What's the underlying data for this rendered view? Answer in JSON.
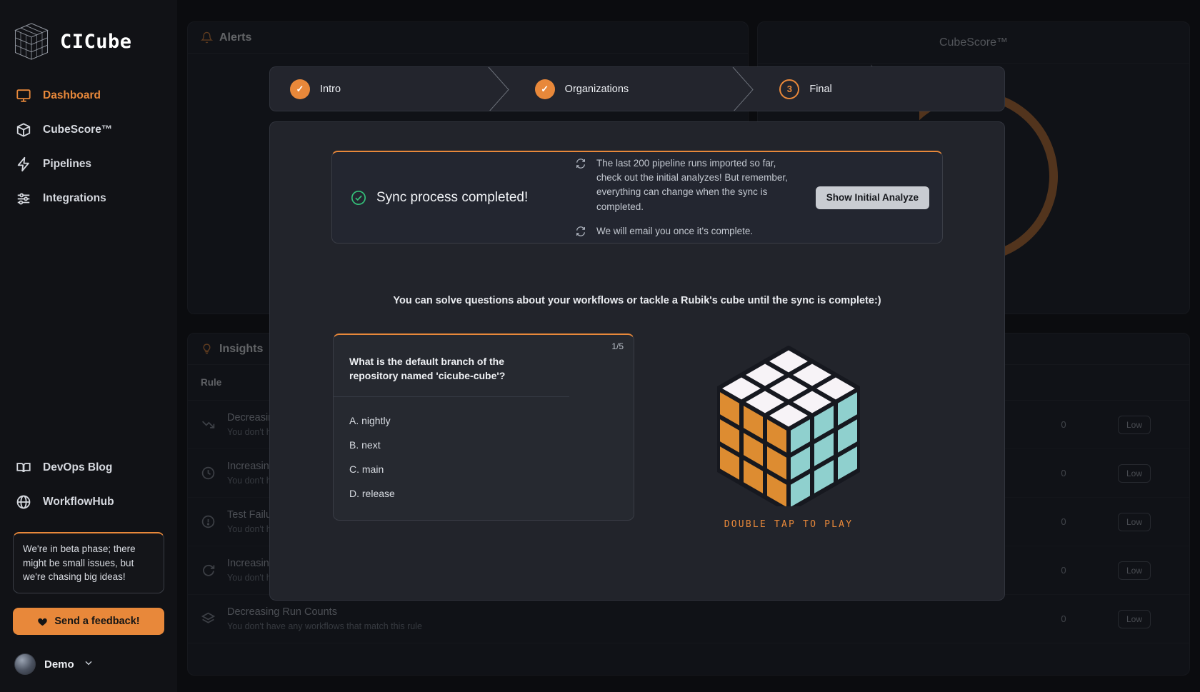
{
  "sidebar": {
    "brand": {
      "name": "CICube",
      "logo_icon": "rubiks-cube-icon"
    },
    "items": [
      {
        "label": "Dashboard",
        "icon": "monitor-icon",
        "active": true
      },
      {
        "label": "CubeScore™",
        "icon": "cube-icon",
        "active": false
      },
      {
        "label": "Pipelines",
        "icon": "lightning-icon",
        "active": false
      },
      {
        "label": "Integrations",
        "icon": "sliders-icon",
        "active": false
      }
    ],
    "bottom_items": [
      {
        "label": "DevOps Blog",
        "icon": "book-icon"
      },
      {
        "label": "WorkflowHub",
        "icon": "globe-icon"
      }
    ],
    "beta_notice": "We're in beta phase; there might be small issues, but we're chasing big ideas!",
    "feedback_button": {
      "label": "Send a feedback!",
      "icon": "heart-icon"
    },
    "user": {
      "name": "Demo",
      "chevron_icon": "chevron-down-icon",
      "avatar_icon": "avatar"
    }
  },
  "background": {
    "alerts_panel": {
      "title": "Alerts",
      "icon": "bell-icon"
    },
    "cubescore_panel": {
      "title": "CubeScore™"
    },
    "insights_panel": {
      "title": "Insights",
      "icon": "lightbulb-icon",
      "column_header": "Rule",
      "rows": [
        {
          "title": "Decreasing Run Counts",
          "subtitle": "You don't have any workflows that match this rule",
          "icon": "trend-down-icon",
          "count": "0",
          "badge": "Low"
        },
        {
          "title": "Increasing Run Durations",
          "subtitle": "You don't have any workflows that match this rule",
          "icon": "clock-icon",
          "count": "0",
          "badge": "Low"
        },
        {
          "title": "Test Failures",
          "subtitle": "You don't have any workflows that match this rule",
          "icon": "alert-circle-icon",
          "count": "0",
          "badge": "Low"
        },
        {
          "title": "Increasing Retry Counts",
          "subtitle": "You don't have any workflows that match this rule",
          "icon": "refresh-icon",
          "count": "0",
          "badge": "Low"
        },
        {
          "title": "Decreasing Run Counts",
          "subtitle": "You don't have any workflows that match this rule",
          "icon": "layers-icon",
          "count": "0",
          "badge": "Low"
        }
      ]
    }
  },
  "modal": {
    "steps": [
      {
        "label": "Intro",
        "marker": "✓",
        "state": "done"
      },
      {
        "label": "Organizations",
        "marker": "✓",
        "state": "done"
      },
      {
        "label": "Final",
        "marker": "3",
        "state": "current"
      }
    ],
    "sync": {
      "status_icon": "check-circle-icon",
      "title": "Sync process completed!",
      "lines": [
        {
          "icon": "sync-icon",
          "text": "The last 200 pipeline runs imported so far, check out the initial analyzes! But remember, everything can change when the sync is completed."
        },
        {
          "icon": "sync-icon",
          "text": "We will email you once it's complete."
        }
      ],
      "button_label": "Show Initial Analyze"
    },
    "prompt": "You can solve questions about your workflows or tackle a Rubik's cube until the sync is complete:)",
    "quiz": {
      "counter": "1/5",
      "question": "What is the default branch of the repository named 'cicube-cube'?",
      "options": [
        "A. nightly",
        "B. next",
        "C. main",
        "D. release"
      ]
    },
    "cube": {
      "cta": "DOUBLE TAP TO PLAY",
      "top_color": "#f7f3f7",
      "left_color": "#dd8c31",
      "right_color": "#8fd0ce",
      "edge_color": "#16181f"
    }
  },
  "colors": {
    "accent": "#e8883a",
    "success": "#34c27a",
    "bg": "#0e0f12",
    "panel": "#1c1e25",
    "modal": "#22242b"
  }
}
